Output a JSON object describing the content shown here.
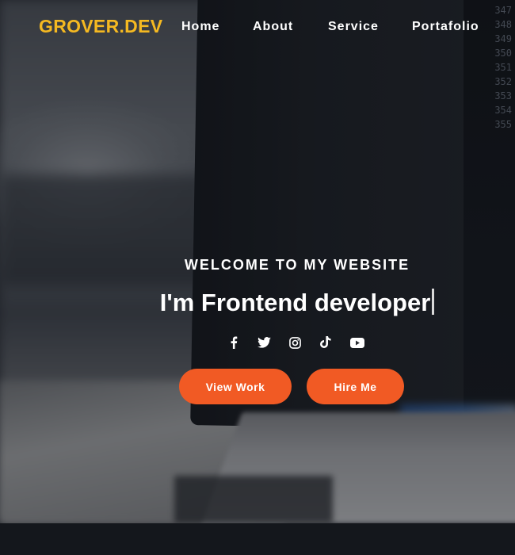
{
  "nav": {
    "logo": "GROVER.DEV",
    "links": [
      "Home",
      "About",
      "Service",
      "Portafolio"
    ]
  },
  "hero": {
    "welcome": "WELCOME TO MY WEBSITE",
    "headline": "I'm Frontend developer",
    "socials": [
      "facebook-icon",
      "twitter-icon",
      "instagram-icon",
      "tiktok-icon",
      "youtube-icon"
    ],
    "buttons": {
      "view_work": "View Work",
      "hire_me": "Hire Me"
    }
  },
  "background": {
    "code_line_numbers": [
      "347",
      "348",
      "349",
      "350",
      "351",
      "352",
      "353",
      "354",
      "355"
    ]
  },
  "colors": {
    "logo": "#f5b921",
    "button": "#f15a24",
    "footer": "#14171c"
  }
}
